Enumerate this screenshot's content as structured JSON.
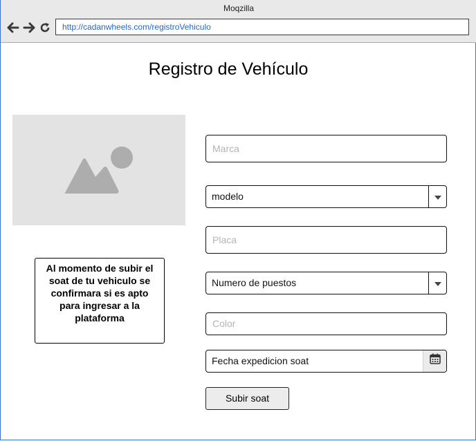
{
  "browser": {
    "window_title": "Moqzilla",
    "url": "http://cadanwheels.com/registroVehiculo",
    "icons": {
      "back": "arrow-left-icon",
      "forward": "arrow-right-icon",
      "reload": "reload-icon"
    }
  },
  "page": {
    "title": "Registro de Vehículo",
    "image_icon": "image-placeholder-icon",
    "notice": "Al momento de subir el soat de tu vehiculo se confirmara si es apto para ingresar a la plataforma"
  },
  "form": {
    "marca_placeholder": "Marca",
    "modelo_selected": "modelo",
    "placa_placeholder": "Placa",
    "puestos_selected": "Numero de puestos",
    "color_placeholder": "Color",
    "fecha_label": "Fecha expedicion soat",
    "submit_label": "Subir soat"
  },
  "colors": {
    "accent": "#3c6fd6",
    "url_text": "#2467c8",
    "placeholder_text": "#b4b4b4"
  }
}
